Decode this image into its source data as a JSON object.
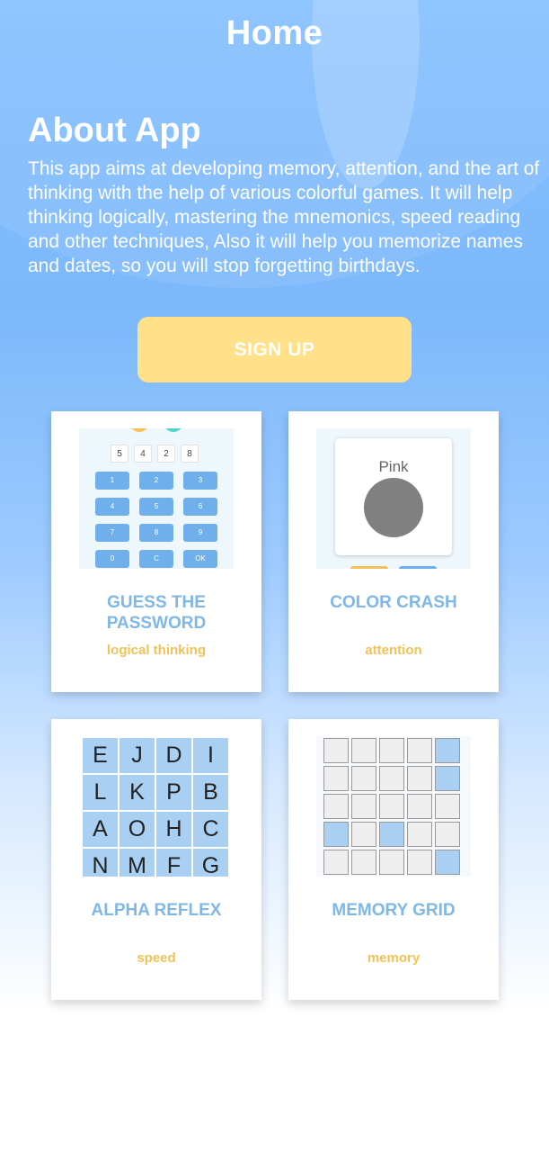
{
  "header": {
    "title": "Home"
  },
  "about": {
    "title": "About App",
    "text": "This app aims at developing memory, attention, and the art of thinking with the help of various colorful games. It will help thinking logically, mastering the mnemonics, speed reading and other techniques, Also it will help you memorize names and dates, so you will stop forgetting birthdays."
  },
  "signup": {
    "label": "SIGN UP"
  },
  "colors": {
    "accent": "#7fb8e6",
    "tag": "#f1c256",
    "button": "#ffe18a"
  },
  "games": [
    {
      "name": "GUESS THE PASSWORD",
      "tag": "logical thinking"
    },
    {
      "name": "COLOR CRASH",
      "tag": "attention"
    },
    {
      "name": "ALPHA REFLEX",
      "tag": "speed"
    },
    {
      "name": "MEMORY GRID",
      "tag": "memory"
    }
  ],
  "password_thumb": {
    "digits": [
      "5",
      "4",
      "2",
      "8"
    ],
    "keys": [
      "1",
      "2",
      "3",
      "4",
      "5",
      "6",
      "7",
      "8",
      "9",
      "0",
      "C",
      "OK"
    ]
  },
  "color_thumb": {
    "word": "Pink"
  },
  "alpha_thumb": {
    "letters": [
      "E",
      "J",
      "D",
      "I",
      "L",
      "K",
      "P",
      "B",
      "A",
      "O",
      "H",
      "C",
      "N",
      "M",
      "F",
      "G"
    ]
  },
  "memory_thumb": {
    "cells": [
      0,
      0,
      0,
      0,
      1,
      0,
      0,
      0,
      0,
      1,
      0,
      0,
      0,
      0,
      0,
      1,
      0,
      1,
      0,
      0,
      0,
      0,
      0,
      0,
      1
    ]
  }
}
